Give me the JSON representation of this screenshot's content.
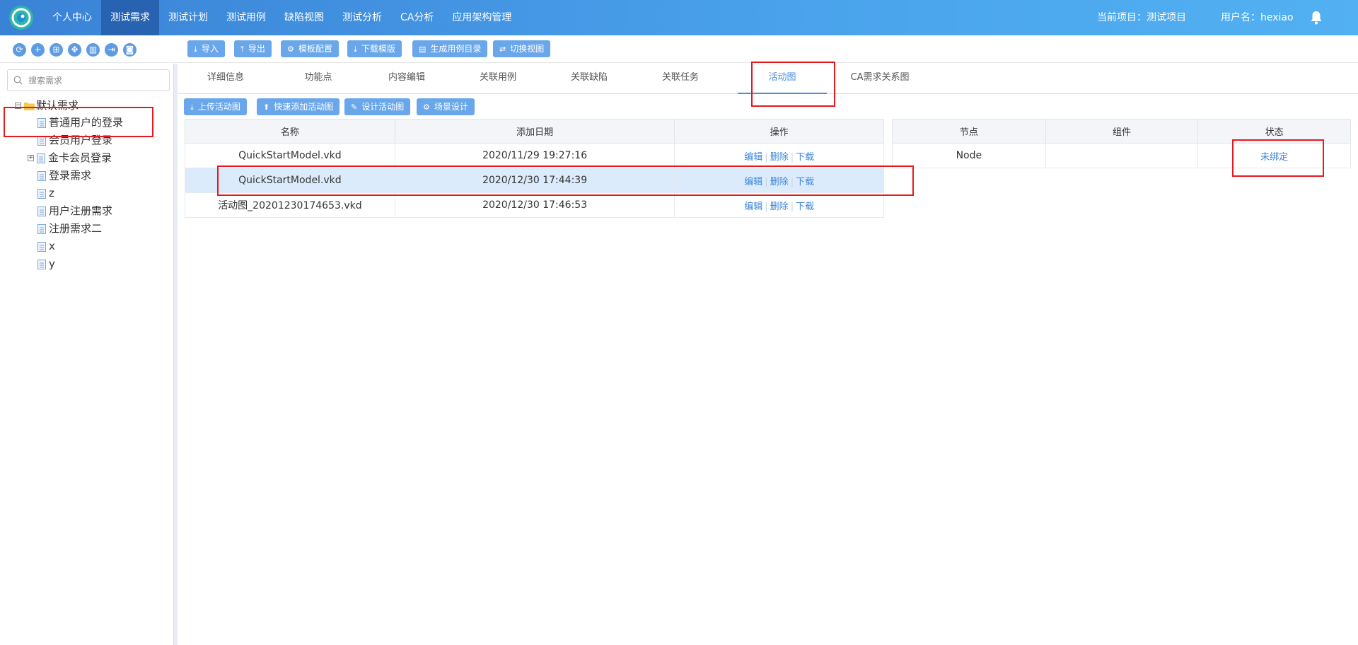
{
  "topbar": {
    "nav": [
      {
        "label": "个人中心"
      },
      {
        "label": "测试需求"
      },
      {
        "label": "测试计划"
      },
      {
        "label": "测试用例"
      },
      {
        "label": "缺陷视图"
      },
      {
        "label": "测试分析"
      },
      {
        "label": "CA分析"
      },
      {
        "label": "应用架构管理"
      }
    ],
    "active_nav": "测试需求",
    "project": "当前项目：测试项目",
    "user": "用户名：hexiao"
  },
  "toolbar": {
    "round_icons": [
      "refresh-icon",
      "add-icon",
      "grid-icon",
      "move-icon",
      "delete-icon",
      "export-icon",
      "view-icon"
    ],
    "buttons": [
      {
        "label": "导入",
        "icon": "import-icon"
      },
      {
        "label": "导出",
        "icon": "export-icon"
      },
      {
        "label": "模板配置",
        "icon": "gear-icon"
      },
      {
        "label": "下载模版",
        "icon": "download-icon"
      },
      {
        "label": "生成用例目录",
        "icon": "document-icon"
      },
      {
        "label": "切换视图",
        "icon": "swap-icon"
      }
    ]
  },
  "search": {
    "placeholder": "搜索需求",
    "value": ""
  },
  "tree": {
    "root": "默认需求",
    "items": [
      {
        "label": "普通用户的登录"
      },
      {
        "label": "会员用户登录"
      },
      {
        "label": "金卡会员登录",
        "expandable": true
      },
      {
        "label": "登录需求"
      },
      {
        "label": "z"
      },
      {
        "label": "用户注册需求"
      },
      {
        "label": "注册需求二"
      },
      {
        "label": "x"
      },
      {
        "label": "y"
      }
    ],
    "selected": "普通用户的登录"
  },
  "tabs": {
    "items": [
      {
        "label": "详细信息"
      },
      {
        "label": "功能点"
      },
      {
        "label": "内容编辑"
      },
      {
        "label": "关联用例"
      },
      {
        "label": "关联缺陷"
      },
      {
        "label": "关联任务"
      },
      {
        "label": "活动图"
      },
      {
        "label": "CA需求关系图"
      }
    ],
    "active": "活动图"
  },
  "actions": [
    {
      "label": "上传活动图",
      "icon": "upload-icon"
    },
    {
      "label": "快速添加活动图",
      "icon": "arrow-up-icon"
    },
    {
      "label": "设计活动图",
      "icon": "edit-icon"
    },
    {
      "label": "场景设计",
      "icon": "gear-icon"
    }
  ],
  "files_table": {
    "headers": [
      "名称",
      "添加日期",
      "操作"
    ],
    "rows": [
      {
        "name": "QuickStartModel.vkd",
        "date": "2020/11/29 19:27:16",
        "ops": [
          "编辑",
          "删除",
          "下载"
        ]
      },
      {
        "name": "QuickStartModel.vkd",
        "date": "2020/12/30 17:44:39",
        "ops": [
          "编辑",
          "删除",
          "下载"
        ],
        "selected": true
      },
      {
        "name": "活动图_20201230174653.vkd",
        "date": "2020/12/30 17:46:53",
        "ops": [
          "编辑",
          "删除",
          "下载"
        ]
      }
    ]
  },
  "nodes_table": {
    "headers": [
      "节点",
      "组件",
      "状态"
    ],
    "rows": [
      {
        "node": "Node",
        "component": "",
        "status": "未绑定"
      }
    ]
  },
  "colors": {
    "accent": "#3a86d8",
    "topbar": "#3a82d6",
    "highlight": "#e8191e",
    "selected_row": "#dcebfb"
  }
}
